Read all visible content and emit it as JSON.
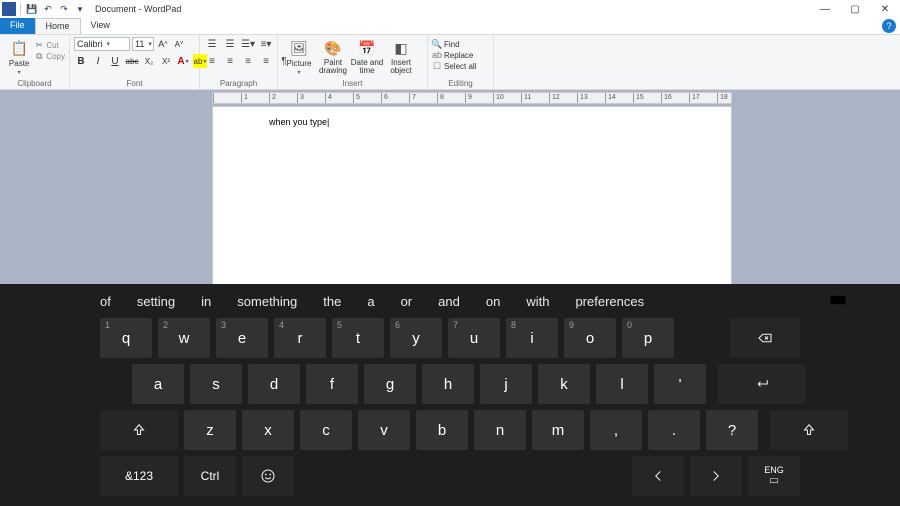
{
  "titlebar": {
    "title": "Document - WordPad",
    "qat": {
      "save": "💾",
      "undo": "↶",
      "redo": "↷"
    },
    "win": {
      "min": "—",
      "max": "▢",
      "close": "✕"
    }
  },
  "tabs": {
    "file": "File",
    "home": "Home",
    "view": "View",
    "help": "?"
  },
  "ribbon": {
    "clipboard": {
      "label": "Clipboard",
      "paste": "Paste",
      "cut": "Cut",
      "copy": "Copy"
    },
    "font": {
      "label": "Font",
      "family": "Calibri",
      "size": "11",
      "grow": "A˄",
      "shrink": "A˅",
      "bold": "B",
      "italic": "I",
      "underline": "U",
      "strike": "abc",
      "sub": "X₂",
      "sup": "X²",
      "color": "A",
      "highlight": "ab"
    },
    "paragraph": {
      "label": "Paragraph"
    },
    "insert": {
      "label": "Insert",
      "picture": "Picture",
      "paint": "Paint drawing",
      "datetime": "Date and time",
      "object": "Insert object"
    },
    "editing": {
      "label": "Editing",
      "find": "Find",
      "replace": "Replace",
      "selectall": "Select all"
    }
  },
  "ruler": [
    "1",
    "2",
    "3",
    "4",
    "5",
    "6",
    "7",
    "8",
    "9",
    "10",
    "11",
    "12",
    "13",
    "14",
    "15",
    "16",
    "17",
    "18"
  ],
  "document": {
    "text": "when you type"
  },
  "osk": {
    "suggestions": [
      "of",
      "setting",
      "in",
      "something",
      "the",
      "a",
      "or",
      "and",
      "on",
      "with",
      "preferences"
    ],
    "row1": [
      {
        "k": "q",
        "h": "1"
      },
      {
        "k": "w",
        "h": "2"
      },
      {
        "k": "e",
        "h": "3"
      },
      {
        "k": "r",
        "h": "4"
      },
      {
        "k": "t",
        "h": "5"
      },
      {
        "k": "y",
        "h": "6"
      },
      {
        "k": "u",
        "h": "7"
      },
      {
        "k": "i",
        "h": "8"
      },
      {
        "k": "o",
        "h": "9"
      },
      {
        "k": "p",
        "h": "0"
      }
    ],
    "row2": [
      "a",
      "s",
      "d",
      "f",
      "g",
      "h",
      "j",
      "k",
      "l",
      "'"
    ],
    "row3": [
      "z",
      "x",
      "c",
      "v",
      "b",
      "n",
      "m",
      ",",
      ".",
      "?"
    ],
    "row4": {
      "numsym": "&123",
      "ctrl": "Ctrl",
      "left": "<",
      "right": ">",
      "lang_top": "ENG"
    },
    "backspace": "⌫",
    "enter": "↵",
    "shift": "↑"
  }
}
